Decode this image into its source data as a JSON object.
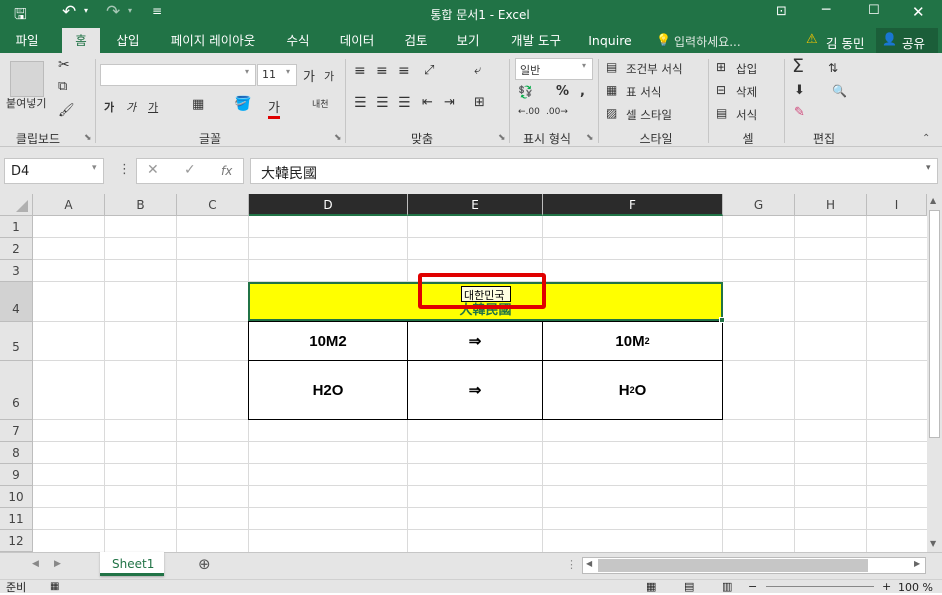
{
  "window": {
    "title": "통합 문서1 - Excel"
  },
  "tabs": [
    "파일",
    "홈",
    "삽입",
    "페이지 레이아웃",
    "수식",
    "데이터",
    "검토",
    "보기",
    "개발 도구",
    "Inquire"
  ],
  "tell_me": "입력하세요...",
  "user": {
    "warning": "⚠",
    "name": "김 동민",
    "share": "공유"
  },
  "ribbon": {
    "clipboard": {
      "paste": "붙여넣기",
      "label": "클립보드"
    },
    "font": {
      "size": "11",
      "grow": "가",
      "shrink": "가",
      "bold": "가",
      "italic": "가",
      "underline": "가",
      "color": "가",
      "phonetic": "내천",
      "label": "글꼴"
    },
    "align": {
      "label": "맞춤"
    },
    "number": {
      "format": "일반",
      "label": "표시 형식"
    },
    "styles": {
      "cond": "조건부 서식",
      "table": "표 서식",
      "cell": "셀 스타일",
      "label": "스타일"
    },
    "cells": {
      "insert": "삽입",
      "delete": "삭제",
      "format": "서식",
      "label": "셀"
    },
    "editing": {
      "label": "편집"
    }
  },
  "formula_bar": {
    "name_box": "D4",
    "content": "大韓民國",
    "fx": "fx"
  },
  "columns": [
    "A",
    "B",
    "C",
    "D",
    "E",
    "F",
    "G",
    "H",
    "I"
  ],
  "rows": [
    "1",
    "2",
    "3",
    "4",
    "5",
    "6",
    "7",
    "8",
    "9",
    "10",
    "11",
    "12"
  ],
  "cells": {
    "D4": "大韓民國",
    "D5": "10M2",
    "E5": "⇒",
    "F5_base": "10M",
    "F5_sup": "2",
    "D6": "H2O",
    "E6": "⇒",
    "F6_a": "H",
    "F6_sub": "2",
    "F6_b": "O"
  },
  "ime_popup": {
    "text": "대한민국"
  },
  "sheet_tabs": [
    "Sheet1"
  ],
  "status": {
    "mode": "준비",
    "zoom": "100 %"
  },
  "colors": {
    "green": "#217346",
    "highlight": "#ffff00",
    "callout": "#e00000"
  }
}
